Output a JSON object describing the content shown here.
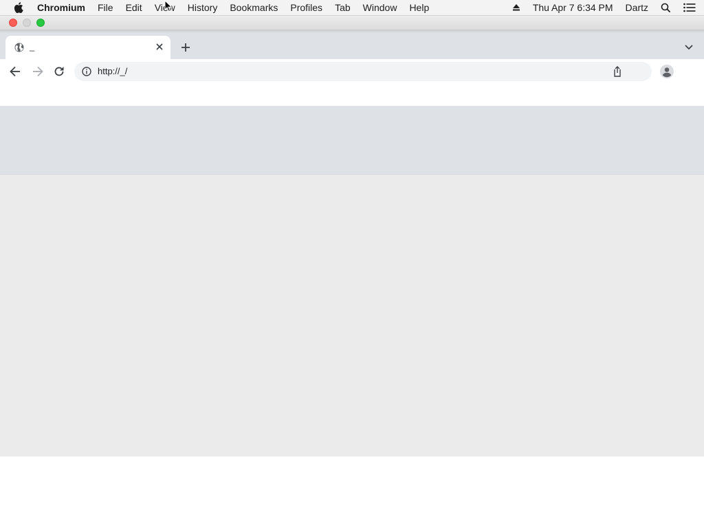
{
  "menubar": {
    "app_name": "Chromium",
    "items": [
      "File",
      "Edit",
      "View",
      "History",
      "Bookmarks",
      "Profiles",
      "Tab",
      "Window",
      "Help"
    ],
    "datetime": "Thu Apr 7  6:34 PM",
    "user": "Dartz",
    "icons": [
      "apple-icon",
      "eject-icon",
      "spotlight-search-icon",
      "notification-center-icon"
    ]
  },
  "tab": {
    "title": "_",
    "favicon": "globe-icon"
  },
  "omnibox": {
    "url": "http://_/"
  },
  "colors": {
    "tabstrip": "#dee1e6",
    "omnibox": "#f1f3f4",
    "content_band": "#dee1e6",
    "content_main": "#ebebeb",
    "close": "#fe5f57",
    "maximize": "#28c840"
  }
}
